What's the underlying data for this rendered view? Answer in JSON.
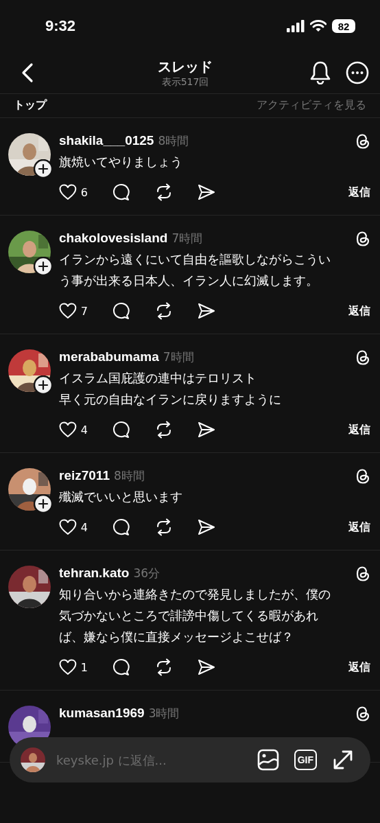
{
  "status_bar": {
    "time": "9:32",
    "battery": "82"
  },
  "header": {
    "title": "スレッド",
    "subtitle": "表示517回"
  },
  "sort_row": {
    "label": "トップ",
    "link": "アクティビティを見る"
  },
  "posts": [
    {
      "username": "shakila___0125",
      "time": "8時間",
      "lines": [
        "旗焼いてやりましょう"
      ],
      "likes": "6",
      "followed": false,
      "reply": "返信"
    },
    {
      "username": "chakolovesisland",
      "time": "7時間",
      "lines": [
        "イランから遠くにいて自由を謳歌しながらこうい",
        "う事が出来る日本人、イラン人に幻滅します。"
      ],
      "likes": "7",
      "followed": false,
      "reply": "返信"
    },
    {
      "username": "merababumama",
      "time": "7時間",
      "lines": [
        "イスラム国庇護の連中はテロリスト",
        "早く元の自由なイランに戻りますように"
      ],
      "likes": "4",
      "followed": false,
      "reply": "返信"
    },
    {
      "username": "reiz7011",
      "time": "8時間",
      "lines": [
        "殲滅でいいと思います"
      ],
      "likes": "4",
      "followed": false,
      "reply": "返信"
    },
    {
      "username": "tehran.kato",
      "time": "36分",
      "lines": [
        "知り合いから連絡きたので発見しましたが、僕の",
        "気づかないところで誹謗中傷してくる暇があれ",
        "ば、嫌なら僕に直接メッセージよこせば？"
      ],
      "likes": "1",
      "followed": true,
      "reply": "返信"
    },
    {
      "username": "kumasan1969",
      "time": "3時間",
      "followed": true
    }
  ],
  "reply_bar": {
    "placeholder": "keyske.jp に返信...",
    "gif": "GIF"
  }
}
